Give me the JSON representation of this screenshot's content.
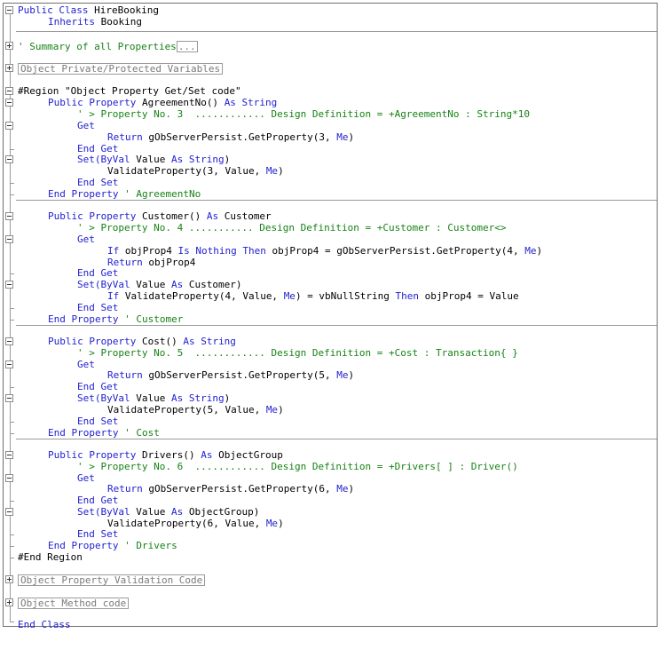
{
  "code_lines": {
    "l01": [
      "Public Class",
      " HireBooking"
    ],
    "l02": [
      "Inherits",
      " Booking"
    ],
    "l03_comment": "' Summary of all Properties",
    "l03_ellipsis": "...",
    "l04_collapsed": "Object Private/Protected Variables",
    "l05": "#Region \"Object Property Get/Set code\"",
    "p1": {
      "decl": [
        "Public Property",
        " AgreementNo() ",
        "As String"
      ],
      "comment": "' > Property No. 3  ............ Design Definition = +AgreementNo : String*10",
      "get": "Get",
      "ret": [
        "Return",
        " gObServerPersist.GetProperty(3, ",
        "Me",
        ")"
      ],
      "endget": "End Get",
      "set": [
        "Set(ByVal",
        " Value ",
        "As String",
        ")"
      ],
      "validate": [
        "ValidateProperty(3, Value, ",
        "Me",
        ")"
      ],
      "endset": "End Set",
      "endprop": [
        "End Property",
        " ' AgreementNo"
      ]
    },
    "p2": {
      "decl": [
        "Public Property",
        " Customer() ",
        "As",
        " Customer"
      ],
      "comment": "' > Property No. 4 ........... Design Definition = +Customer : Customer<>",
      "get": "Get",
      "if": [
        "If",
        " objProp4 ",
        "Is Nothing Then",
        " objProp4 = gObServerPersist.GetProperty(4, ",
        "Me",
        ")"
      ],
      "ret": [
        "Return",
        " objProp4"
      ],
      "endget": "End Get",
      "set": [
        "Set(ByVal",
        " Value ",
        "As",
        " Customer)"
      ],
      "validate": [
        "If",
        " ValidateProperty(4, Value, ",
        "Me",
        ") = vbNullString ",
        "Then",
        " objProp4 = Value"
      ],
      "endset": "End Set",
      "endprop": [
        "End Property",
        " ' Customer"
      ]
    },
    "p3": {
      "decl": [
        "Public Property",
        " Cost() ",
        "As String"
      ],
      "comment": "' > Property No. 5  ............ Design Definition = +Cost : Transaction{ }",
      "get": "Get",
      "ret": [
        "Return",
        " gObServerPersist.GetProperty(5, ",
        "Me",
        ")"
      ],
      "endget": "End Get",
      "set": [
        "Set(ByVal",
        " Value ",
        "As String",
        ")"
      ],
      "validate": [
        "ValidateProperty(5, Value, ",
        "Me",
        ")"
      ],
      "endset": "End Set",
      "endprop": [
        "End Property",
        " ' Cost"
      ]
    },
    "p4": {
      "decl": [
        "Public Property",
        " Drivers() ",
        "As",
        " ObjectGroup"
      ],
      "comment": "' > Property No. 6  ............ Design Definition = +Drivers[ ] : Driver()",
      "get": "Get",
      "ret": [
        "Return",
        " gObServerPersist.GetProperty(6, ",
        "Me",
        ")"
      ],
      "endget": "End Get",
      "set": [
        "Set(ByVal",
        " Value ",
        "As",
        " ObjectGroup)"
      ],
      "validate": [
        "ValidateProperty(6, Value, ",
        "Me",
        ")"
      ],
      "endset": "End Set",
      "endprop": [
        "End Property",
        " ' Drivers"
      ]
    },
    "endregion": "#End Region",
    "collapsed_validation": "Object Property Validation Code",
    "collapsed_method": "Object Method code",
    "endclass": "End Class"
  },
  "colors": {
    "keyword": "#1f1fcf",
    "comment": "#168316",
    "text": "#000000",
    "outline": "#9a9a9a"
  },
  "icons": [
    "collapse-minus-icon",
    "expand-plus-icon"
  ]
}
